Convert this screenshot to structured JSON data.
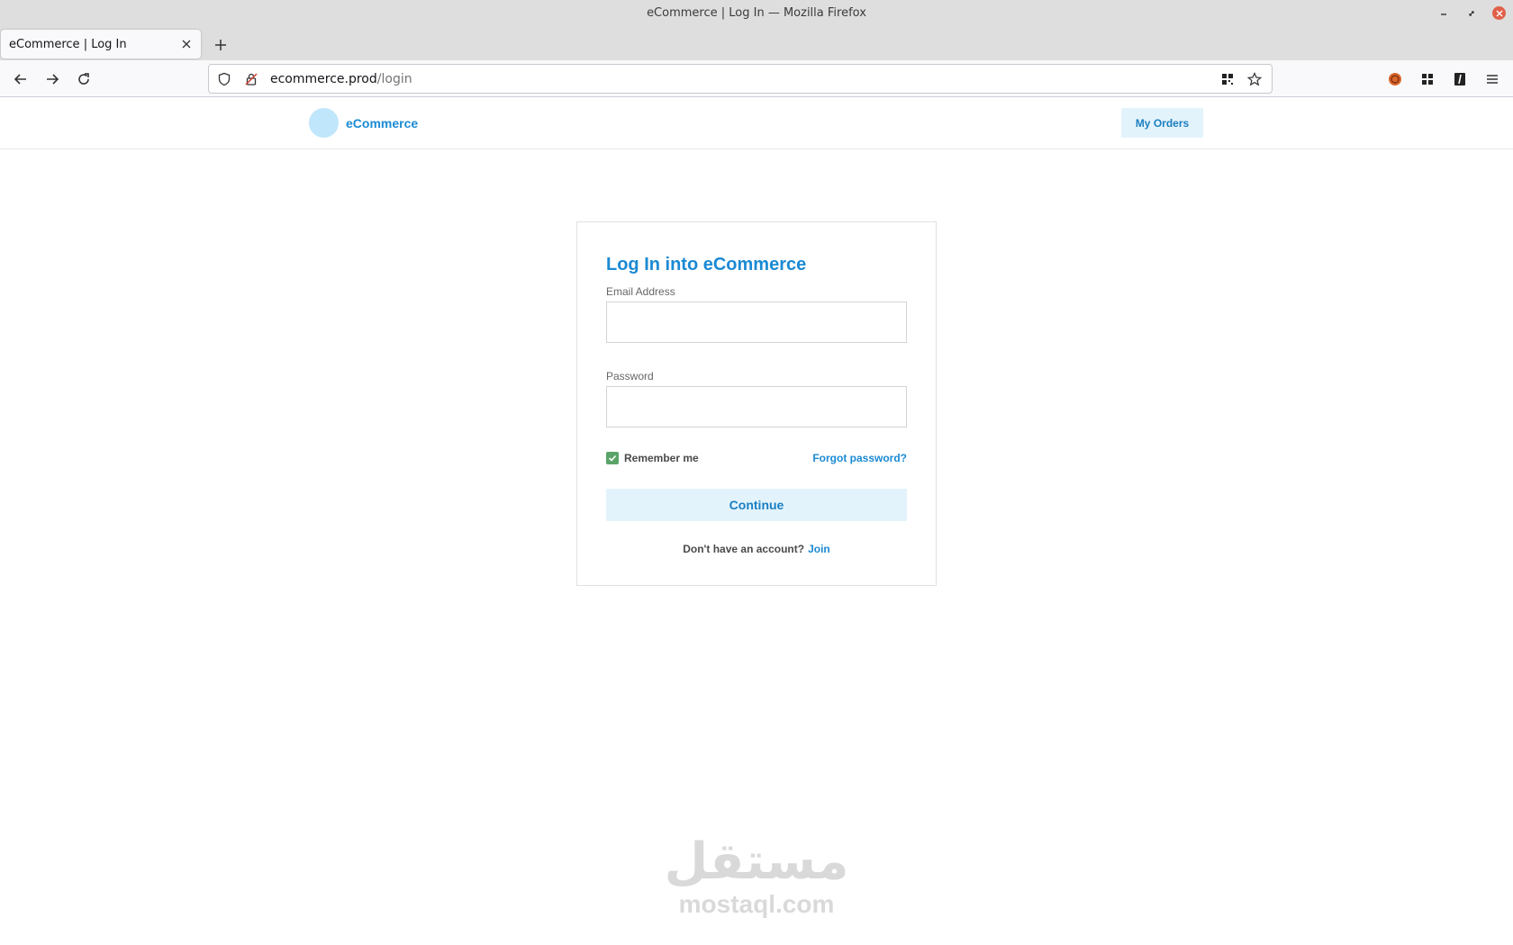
{
  "window": {
    "title": "eCommerce | Log In — Mozilla Firefox"
  },
  "browser": {
    "tab_title": "eCommerce | Log In",
    "url_host": "ecommerce.prod",
    "url_path": "/login"
  },
  "site": {
    "brand_name": "eCommerce",
    "nav_orders": "My Orders",
    "brand_color": "#1b8ad3"
  },
  "login": {
    "title": "Log In into eCommerce",
    "email_label": "Email Address",
    "email_value": "",
    "password_label": "Password",
    "password_value": "",
    "remember_label": "Remember me",
    "remember_checked": true,
    "forgot_label": "Forgot password?",
    "continue_label": "Continue",
    "signup_prompt": "Don't have an account?",
    "join_label": "Join"
  },
  "watermark": {
    "arabic": "مستقل",
    "latin": "mostaql.com"
  }
}
